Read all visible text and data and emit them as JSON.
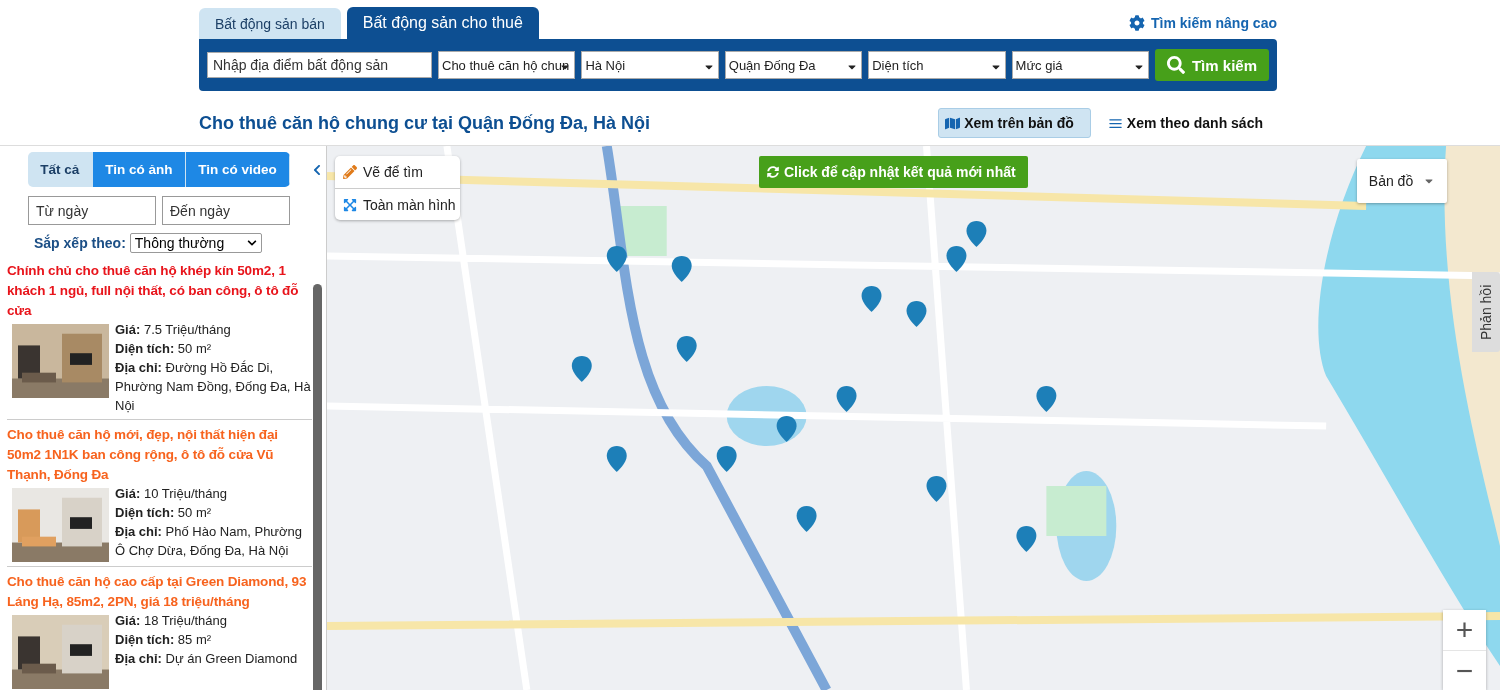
{
  "top_tabs": [
    {
      "label": "Bất động sản bán",
      "selected": false
    },
    {
      "label": "Bất động sản cho thuê",
      "selected": true
    }
  ],
  "advanced_search": "Tìm kiếm nâng cao",
  "search_bar": {
    "location": {
      "placeholder": "Nhập địa điểm bất động sản"
    },
    "selects": [
      "Cho thuê căn hộ chun",
      "Hà Nội",
      "Quận Đống Đa",
      "Diện tích",
      "Mức giá"
    ],
    "button": "Tìm kiếm"
  },
  "heading": "Cho thuê căn hộ chung cư tại Quận Đống Đa, Hà Nội",
  "view_modes": [
    {
      "kind": "map",
      "label": "Xem trên bản đồ",
      "selected": true
    },
    {
      "kind": "list",
      "label": "Xem theo danh sách",
      "selected": false
    }
  ],
  "filter_tabs": [
    {
      "label": "Tất cả",
      "selected": true
    },
    {
      "label": "Tin có ảnh",
      "selected": false
    },
    {
      "label": "Tin có video",
      "selected": false
    }
  ],
  "date_from": {
    "placeholder": "Từ ngày"
  },
  "date_to": {
    "placeholder": "Đến ngày"
  },
  "sort": {
    "label": "Sắp xếp theo:",
    "value": "Thông thường"
  },
  "listings": [
    {
      "title": "Chính chủ cho thuê căn hộ khép kín 50m2, 1 khách 1 ngủ, full nội thất, có ban công, ô tô đỗ cửa",
      "color": "#e8141b",
      "image": {
        "kind": "picture"
      },
      "fields": [
        "**Giá:** 7.5 Triệu/tháng",
        "**Diện tích:** 50 m²",
        "**Địa chỉ:** Đường Hồ Đắc Di, Phường Nam Đồng, Đống Đa, Hà Nội"
      ]
    },
    {
      "title": "Cho thuê căn hộ mới, đẹp, nội thất hiện đại 50m2 1N1K ban công rộng, ô tô đỗ cửa Vũ Thạnh, Đống Đa",
      "color": "#f7631e",
      "image": {
        "kind": "picture"
      },
      "fields": [
        "**Giá:** 10 Triệu/tháng",
        "**Diện tích:** 50 m²",
        "**Địa chỉ:** Phố Hào Nam, Phường Ô Chợ Dừa, Đống Đa, Hà Nội"
      ]
    },
    {
      "title": "Cho thuê căn hộ cao cấp tại Green Diamond, 93 Láng Hạ, 85m2, 2PN, giá 18 triệu/tháng",
      "color": "#f7631e",
      "image": {
        "kind": "picture"
      },
      "fields": [
        "**Giá:** 18 Triệu/tháng",
        "**Diện tích:** 85 m²",
        "**Địa chỉ:** Dự án Green Diamond"
      ]
    }
  ],
  "map": {
    "picture": {
      "kind": "picture"
    },
    "tools": [
      "Vẽ để tìm",
      "Toàn màn hình"
    ],
    "refresh_button": "Click để cập nhật kết quả mới nhất",
    "map_type": "Bản đồ",
    "feedback": "Phản hồi",
    "zoom_in": "+",
    "zoom_out": "−"
  }
}
